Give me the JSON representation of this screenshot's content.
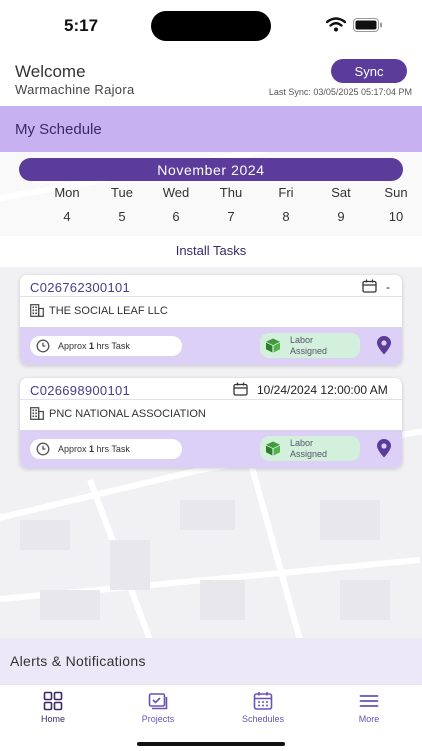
{
  "status_bar": {
    "time": "5:17"
  },
  "header": {
    "welcome": "Welcome",
    "user_name": "Warmachine Rajora",
    "sync_label": "Sync",
    "last_sync": "Last Sync: 03/05/2025 05:17:04 PM"
  },
  "schedule": {
    "title": "My Schedule",
    "month": "November  2024",
    "days": [
      {
        "name": "Mon",
        "num": "4"
      },
      {
        "name": "Tue",
        "num": "5"
      },
      {
        "name": "Wed",
        "num": "6"
      },
      {
        "name": "Thu",
        "num": "7"
      },
      {
        "name": "Fri",
        "num": "8"
      },
      {
        "name": "Sat",
        "num": "9"
      },
      {
        "name": "Sun",
        "num": "10"
      }
    ]
  },
  "install": {
    "title": "Install Tasks",
    "tasks": [
      {
        "id": "C026762300101",
        "date": "-",
        "company": "THE SOCIAL LEAF LLC",
        "approx_prefix": "Approx ",
        "approx_hours": "1",
        "approx_suffix": " hrs Task",
        "labor_line1": "Labor",
        "labor_line2": "Assigned"
      },
      {
        "id": "C026698900101",
        "date": "10/24/2024 12:00:00 AM",
        "company": "PNC NATIONAL ASSOCIATION",
        "approx_prefix": "Approx ",
        "approx_hours": "1",
        "approx_suffix": " hrs Task",
        "labor_line1": "Labor",
        "labor_line2": "Assigned"
      }
    ]
  },
  "alerts": {
    "title": "Alerts & Notifications"
  },
  "tabbar": {
    "tabs": [
      {
        "label": "Home",
        "icon": "home-grid-icon"
      },
      {
        "label": "Projects",
        "icon": "projects-icon"
      },
      {
        "label": "Schedules",
        "icon": "calendar-icon"
      },
      {
        "label": "More",
        "icon": "menu-icon"
      }
    ]
  },
  "colors": {
    "accent": "#5b3c9a",
    "schedule_bar": "#c7b1f0",
    "card_footer": "#ddd0f7",
    "labor_badge": "#d2f0dc"
  }
}
